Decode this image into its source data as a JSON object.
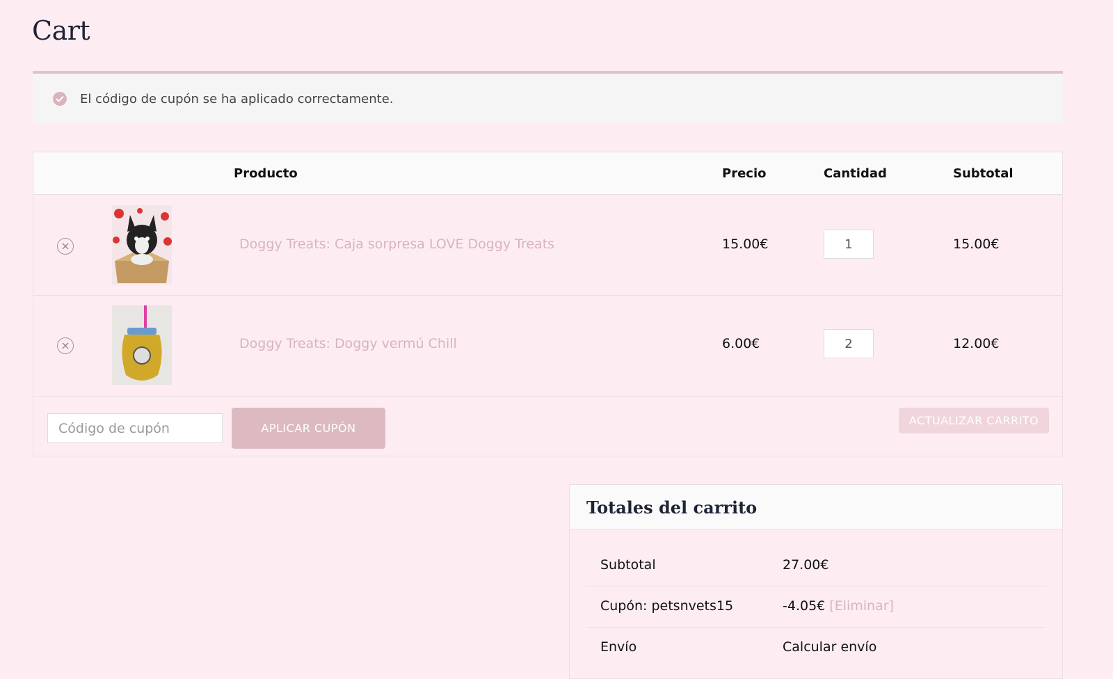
{
  "page": {
    "title": "Cart"
  },
  "notice": {
    "message": "El código de cupón se ha aplicado correctamente."
  },
  "table": {
    "headers": {
      "product": "Producto",
      "price": "Precio",
      "quantity": "Cantidad",
      "subtotal": "Subtotal"
    },
    "rows": [
      {
        "name": "Doggy Treats: Caja sorpresa LOVE Doggy Treats",
        "price": "15.00€",
        "quantity": "1",
        "subtotal": "15.00€",
        "image": "puppy-box"
      },
      {
        "name": "Doggy Treats: Doggy vermú Chill",
        "price": "6.00€",
        "quantity": "2",
        "subtotal": "12.00€",
        "image": "drink-jar"
      }
    ],
    "remove_icon": "×"
  },
  "coupon": {
    "placeholder": "Código de cupón",
    "apply_label": "APLICAR CUPÓN",
    "update_label": "ACTUALIZAR CARRITO"
  },
  "totals": {
    "heading": "Totales del carrito",
    "subtotal_label": "Subtotal",
    "subtotal_value": "27.00€",
    "coupon_label": "Cupón: petsnvets15",
    "coupon_value": "-4.05€",
    "coupon_remove": "[Eliminar]",
    "shipping_label": "Envío",
    "shipping_value": "Calcular envío"
  },
  "colors": {
    "background": "#fdedf3",
    "accent": "#dcbac0",
    "link": "#d8b4bb"
  }
}
